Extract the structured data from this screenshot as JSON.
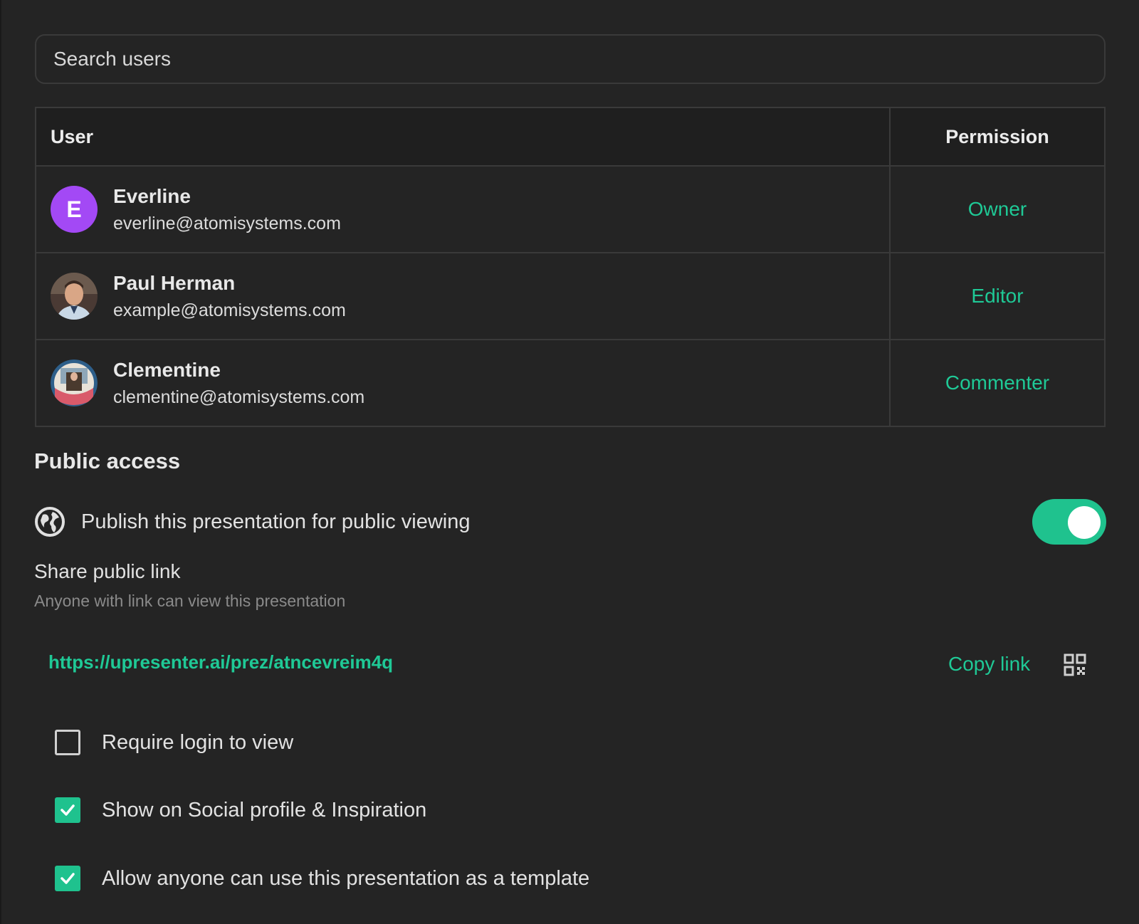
{
  "search": {
    "placeholder": "Search users"
  },
  "table": {
    "headers": {
      "user": "User",
      "permission": "Permission"
    },
    "rows": [
      {
        "name": "Everline",
        "email": "everline@atomisystems.com",
        "permission": "Owner",
        "avatar_initial": "E",
        "avatar_color": "#a349f5"
      },
      {
        "name": "Paul Herman",
        "email": "example@atomisystems.com",
        "permission": "Editor"
      },
      {
        "name": "Clementine",
        "email": "clementine@atomisystems.com",
        "permission": "Commenter"
      }
    ]
  },
  "public_access": {
    "title": "Public access",
    "publish_label": "Publish this presentation for public viewing",
    "publish_enabled": true,
    "share_title": "Share public link",
    "share_subtitle": "Anyone with link can view this presentation",
    "link_url": "https://upresenter.ai/prez/atncevreim4q",
    "copy_label": "Copy link",
    "options": [
      {
        "label": "Require login to view",
        "checked": false
      },
      {
        "label": "Show on Social profile & Inspiration",
        "checked": true
      },
      {
        "label": "Allow anyone can use this presentation as a template",
        "checked": true
      }
    ]
  },
  "colors": {
    "accent": "#1fc996",
    "background": "#242424",
    "border": "#3a3a3a"
  }
}
